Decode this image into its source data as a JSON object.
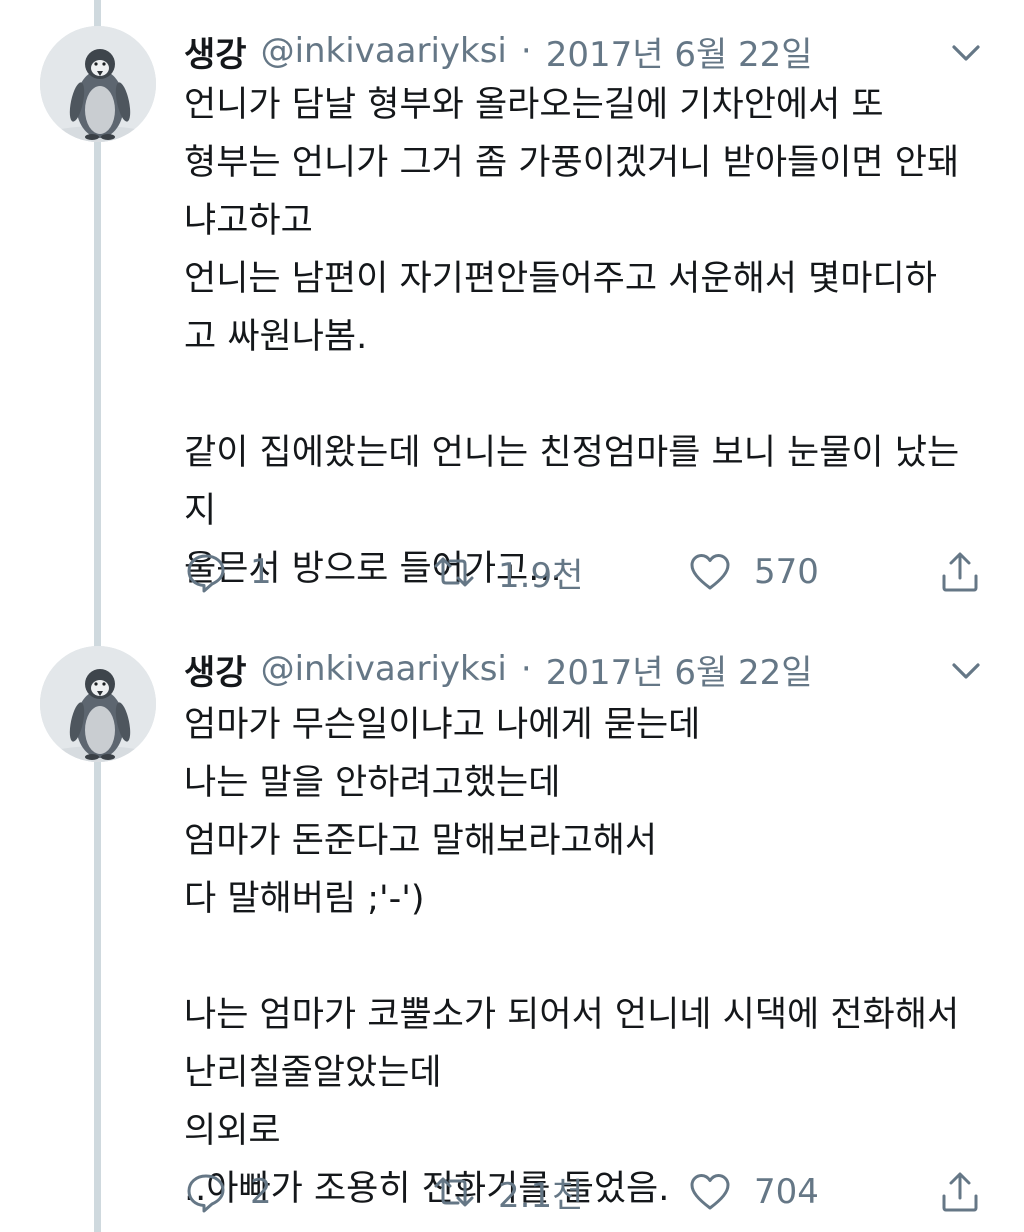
{
  "tweets": [
    {
      "author": {
        "name": "생강",
        "handle": "@inkivaariyksi",
        "avatar_icon": "penguin-avatar"
      },
      "separator": "·",
      "date": "2017년 6월 22일",
      "lines": [
        "언니가 담날 형부와 올라오는길에 기차안에서 또",
        "형부는 언니가 그거 좀 가풍이겠거니 받아들이면 안돼",
        "냐고하고",
        "언니는 남편이 자기편안들어주고 서운해서 몇마디하",
        "고 싸원나봄.",
        "",
        "같이 집에왔는데 언니는 친정엄마를 보니 눈물이 났는",
        "지",
        "울믄서 방으로 들어가고..."
      ],
      "actions": {
        "reply_count": "1",
        "retweet_count": "1.9천",
        "like_count": "570"
      }
    },
    {
      "author": {
        "name": "생강",
        "handle": "@inkivaariyksi",
        "avatar_icon": "penguin-avatar"
      },
      "separator": "·",
      "date": "2017년 6월 22일",
      "lines": [
        "엄마가 무슨일이냐고 나에게 묻는데",
        "나는 말을 안하려고했는데",
        "엄마가 돈준다고 말해보라고해서",
        "다 말해버림 ;'-')",
        "",
        "나는 엄마가 코뿔소가 되어서 언니네 시댁에 전화해서",
        "난리칠줄알았는데",
        "의외로",
        "..아빠가 조용히 전화기를 들었음."
      ],
      "actions": {
        "reply_count": "2",
        "retweet_count": "2.1천",
        "like_count": "704"
      }
    }
  ],
  "icons": {
    "reply": "reply-icon",
    "retweet": "retweet-icon",
    "like": "heart-icon",
    "share": "share-icon",
    "more": "chevron-down-icon"
  },
  "colors": {
    "text": "#14171a",
    "muted": "#657786",
    "thread_line": "#cfd9de"
  }
}
